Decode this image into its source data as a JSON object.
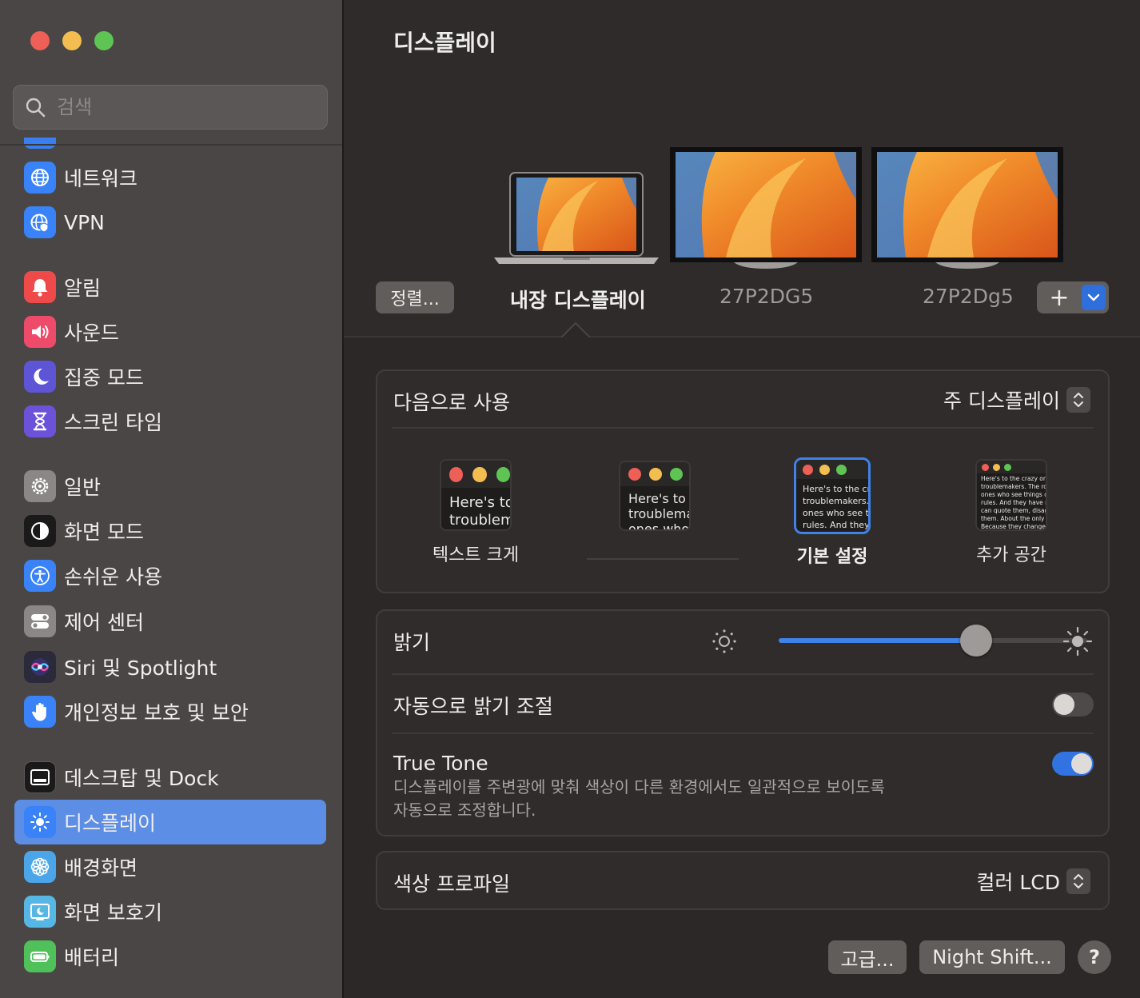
{
  "window": {
    "title": "디스플레이"
  },
  "search": {
    "placeholder": "검색"
  },
  "sidebar": {
    "items": [
      {
        "label": "네트워크",
        "icon": "globe-icon",
        "color": "#3a82f7"
      },
      {
        "label": "VPN",
        "icon": "vpn-globe-icon",
        "color": "#3a82f7"
      },
      {
        "label": "알림",
        "icon": "bell-icon",
        "color": "#ee4a4a"
      },
      {
        "label": "사운드",
        "icon": "speaker-icon",
        "color": "#ee4a6a"
      },
      {
        "label": "집중 모드",
        "icon": "moon-icon",
        "color": "#5d55d6"
      },
      {
        "label": "스크린 타임",
        "icon": "hourglass-icon",
        "color": "#6c52d9"
      },
      {
        "label": "일반",
        "icon": "gear-icon",
        "color": "#8a8786"
      },
      {
        "label": "화면 모드",
        "icon": "appearance-icon",
        "color": "#1b1a1a"
      },
      {
        "label": "손쉬운 사용",
        "icon": "accessibility-icon",
        "color": "#3a82f7"
      },
      {
        "label": "제어 센터",
        "icon": "control-center-icon",
        "color": "#8a8786"
      },
      {
        "label": "Siri 및 Spotlight",
        "icon": "siri-icon",
        "color": "#2a2a3a"
      },
      {
        "label": "개인정보 보호 및 보안",
        "icon": "hand-icon",
        "color": "#3a82f7"
      },
      {
        "label": "데스크탑 및 Dock",
        "icon": "dock-icon",
        "color": "#1b1a1a"
      },
      {
        "label": "디스플레이",
        "icon": "sun-icon",
        "color": "#3a82f7"
      },
      {
        "label": "배경화면",
        "icon": "flower-icon",
        "color": "#4aa6e8"
      },
      {
        "label": "화면 보호기",
        "icon": "screensaver-icon",
        "color": "#57b7e4"
      },
      {
        "label": "배터리",
        "icon": "battery-icon",
        "color": "#4fc05a"
      }
    ],
    "active": "디스플레이"
  },
  "arrangement": {
    "arrange_button": "정렬...",
    "displays": [
      {
        "label": "내장 디스플레이",
        "selected": true
      },
      {
        "label": "27P2DG5",
        "selected": false
      },
      {
        "label": "27P2Dg5",
        "selected": false
      }
    ],
    "add_button": "+"
  },
  "use_as": {
    "label": "다음으로 사용",
    "value": "주 디스플레이"
  },
  "resolution": {
    "options": [
      {
        "name": "텍스트 크게",
        "sample": "Here's to\ntroublem",
        "selected": false
      },
      {
        "name": "",
        "sample": "Here's to t\ntroublema\nones who",
        "selected": false
      },
      {
        "name": "기본 설정",
        "sample": "Here's to the cr\ntroublemakers.\nones who see t\nrules. And they",
        "selected": true
      },
      {
        "name": "추가 공간",
        "sample": "Here's to the crazy one\ntroublemakers. The rou\nones who see things dif\nrules. And they have no\ncan quote them, disagr\nthem. About the only th\nBecause they change th",
        "selected": false
      }
    ]
  },
  "brightness": {
    "label": "밝기",
    "level": 0.64
  },
  "auto_brightness": {
    "label": "자동으로 밝기 조절",
    "enabled": false
  },
  "true_tone": {
    "label": "True Tone",
    "description_line1": "디스플레이를 주변광에 맞춰 색상이 다른 환경에서도 일관적으로 보이도록",
    "description_line2": "자동으로 조정합니다.",
    "enabled": true
  },
  "color_profile": {
    "label": "색상 프로파일",
    "value": "컬러 LCD"
  },
  "buttons": {
    "advanced": "고급...",
    "night_shift": "Night Shift...",
    "help": "?"
  },
  "colors": {
    "accent": "#3f82e8",
    "selection": "#5d8ee6"
  }
}
